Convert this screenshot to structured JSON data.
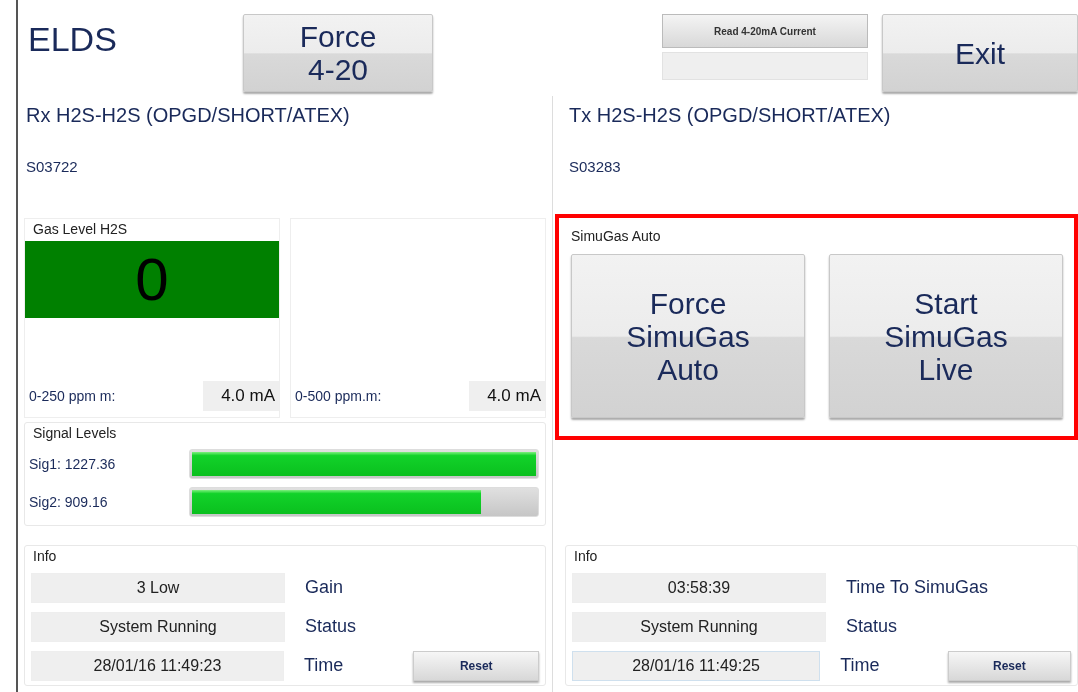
{
  "header": {
    "title": "ELDS",
    "force_button": [
      "Force",
      "4-20"
    ],
    "read_button": "Read 4-20mA Current",
    "exit_button": "Exit"
  },
  "rx": {
    "title": "Rx H2S-H2S (OPGD/SHORT/ATEX)",
    "serial": "S03722",
    "gas_level": {
      "label": "Gas Level H2S",
      "value": "0"
    },
    "ranges": [
      {
        "label": "0-250 ppm m:",
        "reading": "4.0 mA"
      },
      {
        "label": "0-500 ppm.m:",
        "reading": "4.0 mA"
      }
    ],
    "signals": {
      "title": "Signal Levels",
      "items": [
        {
          "label": "Sig1: 1227.36",
          "level": 1.0
        },
        {
          "label": "Sig2: 909.16",
          "level": 0.84
        }
      ]
    },
    "info": {
      "title": "Info",
      "rows": [
        {
          "value": "3 Low",
          "label": "Gain"
        },
        {
          "value": "System Running",
          "label": "Status"
        },
        {
          "value": "28/01/16 11:49:23",
          "label": "Time"
        }
      ],
      "reset_button": "Reset"
    }
  },
  "tx": {
    "title": "Tx H2S-H2S (OPGD/SHORT/ATEX)",
    "serial": "S03283",
    "simugas": {
      "title": "SimuGas Auto",
      "highlighted": true,
      "buttons": [
        [
          "Force",
          "SimuGas",
          "Auto"
        ],
        [
          "Start",
          "SimuGas",
          "Live"
        ]
      ]
    },
    "info": {
      "title": "Info",
      "rows": [
        {
          "value": "03:58:39",
          "label": "Time To SimuGas"
        },
        {
          "value": "System Running",
          "label": "Status"
        },
        {
          "value": "28/01/16 11:49:25",
          "label": "Time"
        }
      ],
      "reset_button": "Reset"
    }
  }
}
